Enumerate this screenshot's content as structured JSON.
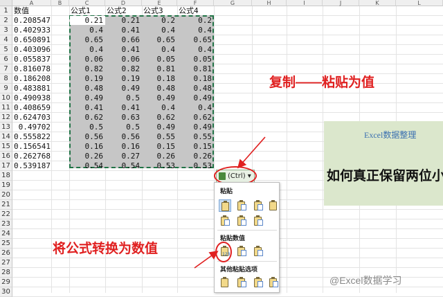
{
  "columns": [
    "A",
    "B",
    "C",
    "D",
    "E",
    "F",
    "G",
    "H",
    "I",
    "J",
    "K",
    "L"
  ],
  "row_numbers": [
    "1",
    "2",
    "3",
    "4",
    "5",
    "6",
    "7",
    "8",
    "9",
    "10",
    "11",
    "12",
    "13",
    "14",
    "15",
    "16",
    "17",
    "18",
    "19",
    "20",
    "21",
    "22",
    "23",
    "24",
    "25",
    "26",
    "27",
    "28",
    "29",
    "30"
  ],
  "headers": {
    "a": "数值",
    "c": "公式1",
    "d": "公式2",
    "e": "公式3",
    "f": "公式4"
  },
  "col_a": [
    "0.208547",
    "0.402933",
    "0.650891",
    "0.403096",
    "0.055837",
    "0.816078",
    "0.186208",
    "0.483881",
    "0.490938",
    "0.408659",
    "0.624703",
    "0.49702",
    "0.555822",
    "0.156541",
    "0.262768",
    "0.539187"
  ],
  "formula_rows": [
    [
      "0.21",
      "0.21",
      "0.2",
      "0.2"
    ],
    [
      "0.4",
      "0.41",
      "0.4",
      "0.4"
    ],
    [
      "0.65",
      "0.66",
      "0.65",
      "0.65"
    ],
    [
      "0.4",
      "0.41",
      "0.4",
      "0.4"
    ],
    [
      "0.06",
      "0.06",
      "0.05",
      "0.05"
    ],
    [
      "0.82",
      "0.82",
      "0.81",
      "0.81"
    ],
    [
      "0.19",
      "0.19",
      "0.18",
      "0.18"
    ],
    [
      "0.48",
      "0.49",
      "0.48",
      "0.48"
    ],
    [
      "0.49",
      "0.5",
      "0.49",
      "0.49"
    ],
    [
      "0.41",
      "0.41",
      "0.4",
      "0.4"
    ],
    [
      "0.62",
      "0.63",
      "0.62",
      "0.62"
    ],
    [
      "0.5",
      "0.5",
      "0.49",
      "0.49"
    ],
    [
      "0.56",
      "0.56",
      "0.55",
      "0.55"
    ],
    [
      "0.16",
      "0.16",
      "0.15",
      "0.15"
    ],
    [
      "0.26",
      "0.27",
      "0.26",
      "0.26"
    ],
    [
      "0.54",
      "0.54",
      "0.53",
      "0.53"
    ]
  ],
  "callouts": {
    "copy_paste_values": "复制——粘贴为值",
    "convert_formula": "将公式转换为数值"
  },
  "side_card": {
    "title": "Excel数据整理",
    "subtitle": "如何真正保留两位小"
  },
  "paste_button": {
    "label": "(Ctrl)",
    "caret": "▾"
  },
  "paste_menu": {
    "section_paste": "粘贴",
    "section_paste_values": "粘贴数值",
    "section_other": "其他粘贴选项",
    "values_tag": "123"
  },
  "watermark": "@Excel数据学习",
  "colors": {
    "selection_border": "#217346",
    "callout": "#e02020",
    "card_bg": "#dbe7cc"
  }
}
